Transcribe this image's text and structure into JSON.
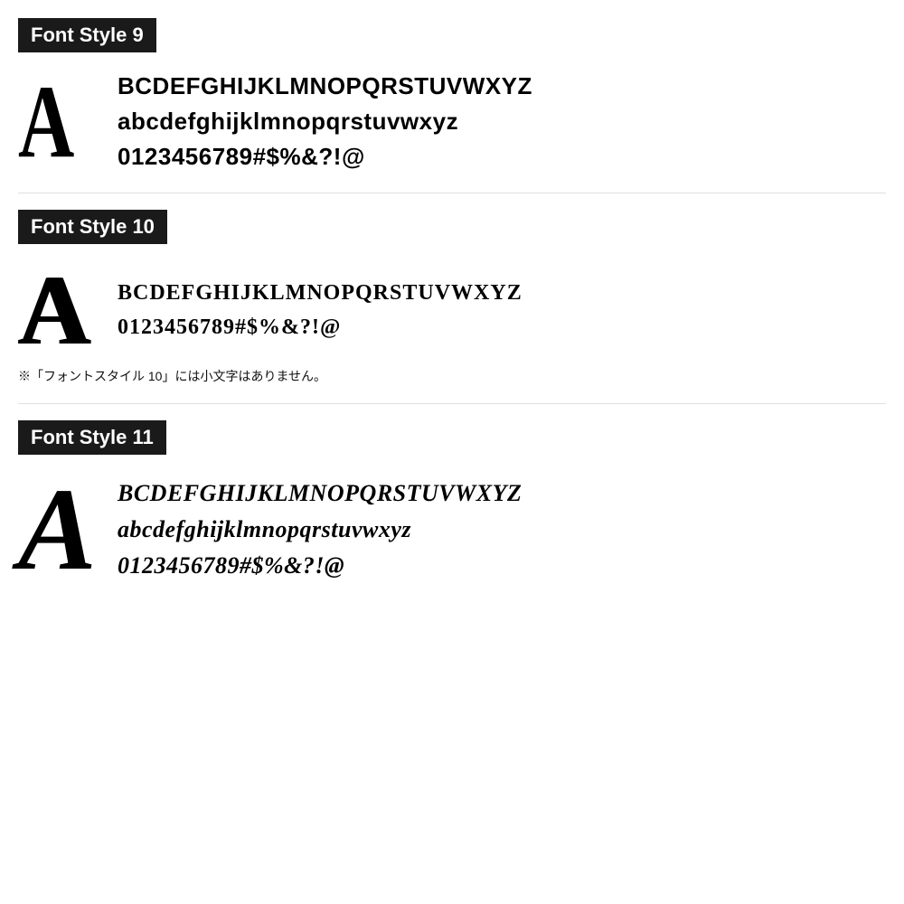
{
  "sections": [
    {
      "id": "font-style-9",
      "label": "Font Style 9",
      "big_letter": "A",
      "lines": [
        "BCDEFGHIJKLMNOPQRSTUVWXYZ",
        "abcdefghijklmnopqrstuvwxyz",
        "0123456789#$%&?!@"
      ],
      "note": null
    },
    {
      "id": "font-style-10",
      "label": "Font Style 10",
      "big_letter": "A",
      "lines": [
        "BCDEFGHIJKLMNOPQRSTUVWXYZ",
        "0123456789#$%&?!@"
      ],
      "note": "※「フォントスタイル 10」には小文字はありません。"
    },
    {
      "id": "font-style-11",
      "label": "Font Style 11",
      "big_letter": "A",
      "lines": [
        "BCDEFGHIJKLMNOPQRSTUVWXYZ",
        "abcdefghijklmnopqrstuvwxyz",
        "0123456789#$%&?!@"
      ],
      "note": null
    }
  ]
}
